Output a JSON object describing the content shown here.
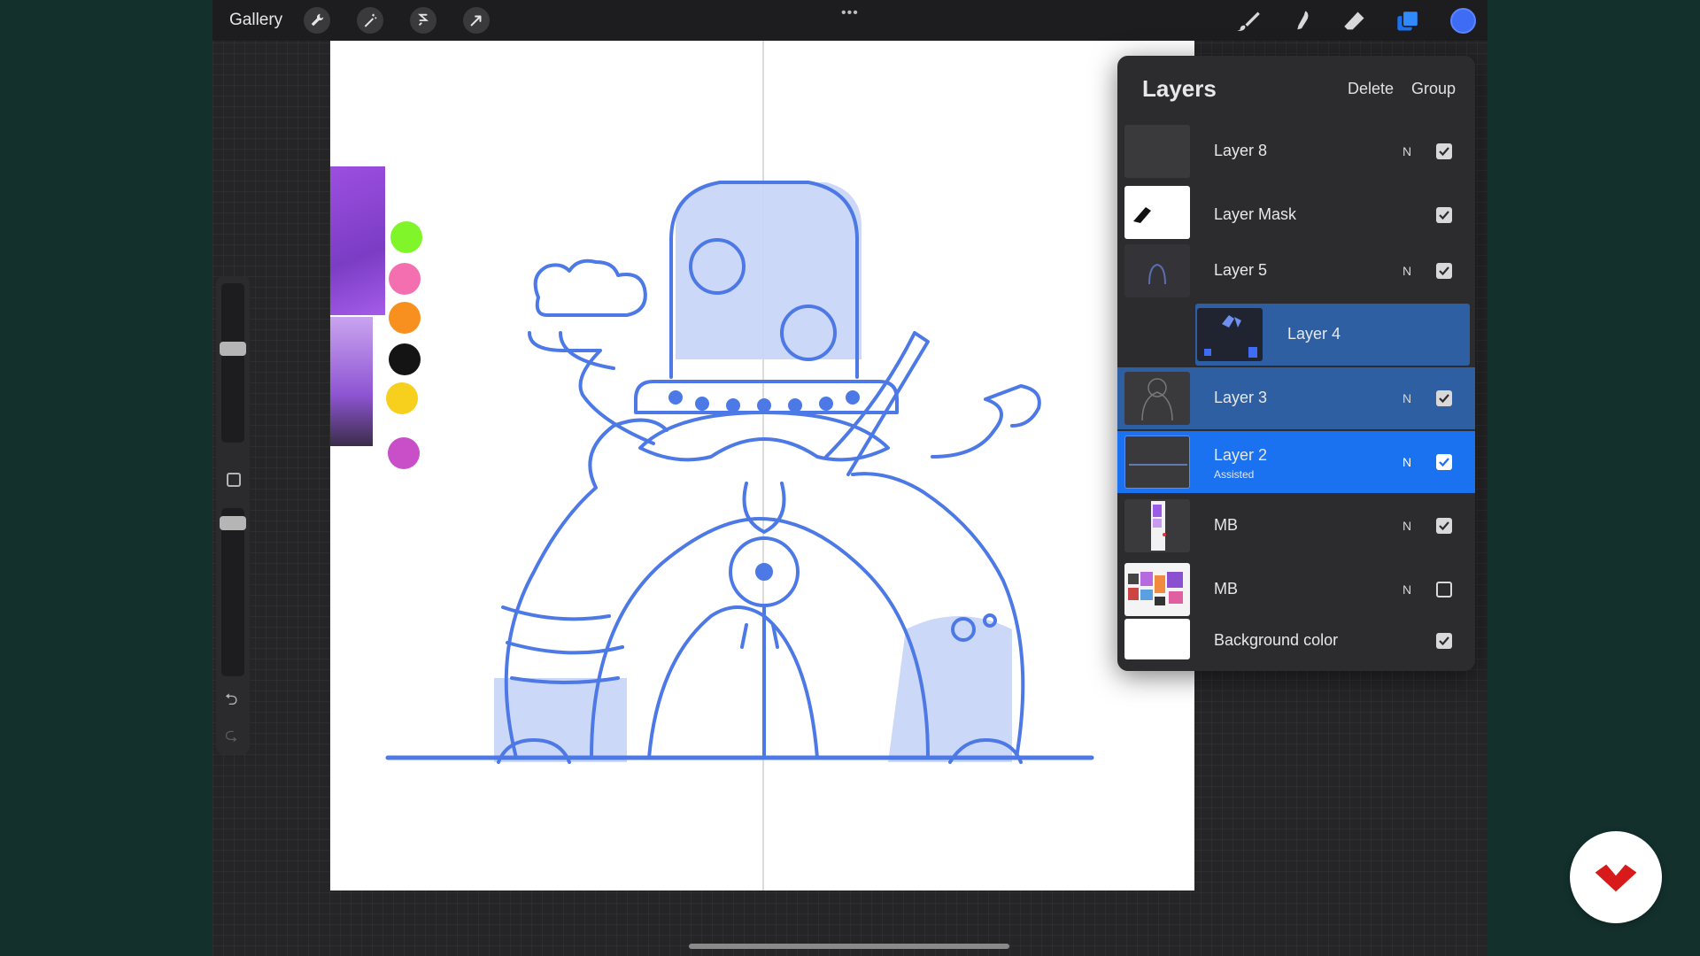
{
  "topbar": {
    "gallery_label": "Gallery",
    "menu_dots": "•••",
    "tools_left": [
      "wrench-icon",
      "magic-wand-icon",
      "selection-icon",
      "transform-arrow-icon"
    ],
    "tools_right": [
      "brush-icon",
      "smudge-icon",
      "eraser-icon",
      "layers-icon",
      "color-icon"
    ],
    "active_color": "#3e6cf4"
  },
  "palette": {
    "colors": [
      "#7ff52a",
      "#f46fb0",
      "#f7901e",
      "#141414",
      "#f7cf1d",
      "#c94fc9"
    ]
  },
  "sidebar": {
    "undo_icon": "undo-icon",
    "redo_icon": "redo-icon",
    "brush_size": 0.6,
    "brush_opacity": 0.95
  },
  "layers_panel": {
    "title": "Layers",
    "delete_label": "Delete",
    "group_label": "Group",
    "layers": [
      {
        "name": "Layer 8",
        "blend": "N",
        "visible": true,
        "state": "normal"
      },
      {
        "name": "Layer Mask",
        "blend": "",
        "visible": true,
        "state": "normal"
      },
      {
        "name": "Layer 5",
        "blend": "N",
        "visible": true,
        "state": "normal"
      },
      {
        "name": "Layer 4",
        "blend": "",
        "visible": true,
        "state": "clipped-selected"
      },
      {
        "name": "Layer 3",
        "blend": "N",
        "visible": true,
        "state": "secondary-selected"
      },
      {
        "name": "Layer 2",
        "sub": "Assisted",
        "blend": "N",
        "visible": true,
        "state": "selected"
      },
      {
        "name": "MB",
        "blend": "N",
        "visible": true,
        "state": "normal"
      },
      {
        "name": "MB",
        "blend": "N",
        "visible": false,
        "state": "normal"
      },
      {
        "name": "Background color",
        "blend": "",
        "visible": true,
        "state": "normal"
      }
    ]
  },
  "colors": {
    "accent": "#1a72f0",
    "sketch": "#4d79e6",
    "fill": "#c9d6f8"
  }
}
